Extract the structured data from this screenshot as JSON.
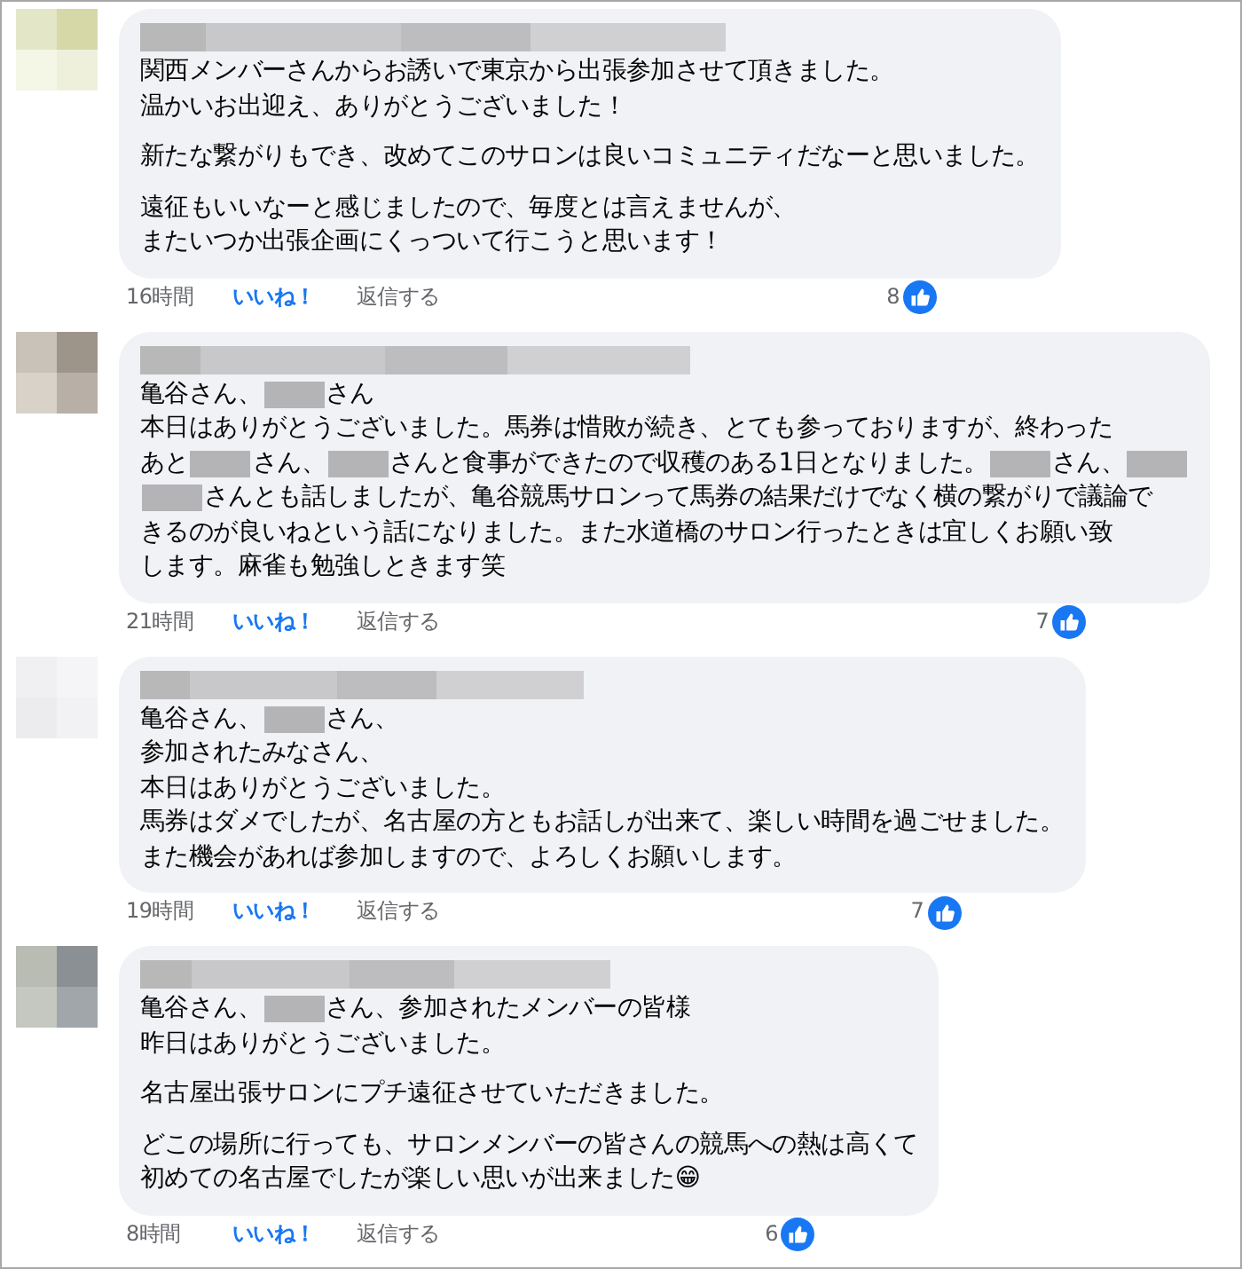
{
  "comments": [
    {
      "paragraphs": [
        [
          [
            {
              "kind": "text",
              "text": "関西メンバーさんからお誘いで東京から出張参加させて頂きました。"
            }
          ],
          [
            {
              "kind": "text",
              "text": "温かいお出迎え、ありがとうございました！"
            }
          ]
        ],
        [
          [
            {
              "kind": "text",
              "text": "新たな繋がりもでき、改めてこのサロンは良いコミュニティだなーと思いました。"
            }
          ]
        ],
        [
          [
            {
              "kind": "text",
              "text": "遠征もいいなーと感じましたので、毎度とは言えませんが、"
            }
          ],
          [
            {
              "kind": "text",
              "text": "またいつか出張企画にくっついて行こうと思います！"
            }
          ]
        ]
      ],
      "time": "16時間",
      "like": "いいね！",
      "reply": "返信する",
      "count": "8"
    },
    {
      "paragraphs": [
        [
          [
            {
              "kind": "text",
              "text": "亀谷さん、"
            },
            {
              "kind": "redacted"
            },
            {
              "kind": "text",
              "text": "さん"
            }
          ],
          [
            {
              "kind": "text",
              "text": "本日はありがとうございました。馬券は惜敗が続き、とても参っておりますが、終わった"
            }
          ],
          [
            {
              "kind": "text",
              "text": "あと"
            },
            {
              "kind": "redacted"
            },
            {
              "kind": "text",
              "text": "さん、"
            },
            {
              "kind": "redacted"
            },
            {
              "kind": "text",
              "text": "さんと食事ができたので収穫のある1日となりました。"
            },
            {
              "kind": "redacted"
            },
            {
              "kind": "text",
              "text": "さん、"
            },
            {
              "kind": "redacted"
            }
          ],
          [
            {
              "kind": "redacted"
            },
            {
              "kind": "text",
              "text": "さんとも話しましたが、亀谷競馬サロンって馬券の結果だけでなく横の繋がりで議論で"
            }
          ],
          [
            {
              "kind": "text",
              "text": "きるのが良いねという話になりました。また水道橋のサロン行ったときは宜しくお願い致"
            }
          ],
          [
            {
              "kind": "text",
              "text": "します。麻雀も勉強しときます笑"
            }
          ]
        ]
      ],
      "time": "21時間",
      "like": "いいね！",
      "reply": "返信する",
      "count": "7"
    },
    {
      "paragraphs": [
        [
          [
            {
              "kind": "text",
              "text": "亀谷さん、"
            },
            {
              "kind": "redacted"
            },
            {
              "kind": "text",
              "text": "さん、"
            }
          ],
          [
            {
              "kind": "text",
              "text": "参加されたみなさん、"
            }
          ],
          [
            {
              "kind": "text",
              "text": "本日はありがとうございました。"
            }
          ],
          [
            {
              "kind": "text",
              "text": "馬券はダメでしたが、名古屋の方ともお話しが出来て、楽しい時間を過ごせました。"
            }
          ],
          [
            {
              "kind": "text",
              "text": "また機会があれば参加しますので、よろしくお願いします。"
            }
          ]
        ]
      ],
      "time": "19時間",
      "like": "いいね！",
      "reply": "返信する",
      "count": "7"
    },
    {
      "paragraphs": [
        [
          [
            {
              "kind": "text",
              "text": "亀谷さん、"
            },
            {
              "kind": "redacted"
            },
            {
              "kind": "text",
              "text": "さん、参加されたメンバーの皆様"
            }
          ],
          [
            {
              "kind": "text",
              "text": "昨日はありがとうございました。"
            }
          ]
        ],
        [
          [
            {
              "kind": "text",
              "text": "名古屋出張サロンにプチ遠征させていただきました。"
            }
          ]
        ],
        [
          [
            {
              "kind": "text",
              "text": "どこの場所に行っても、サロンメンバーの皆さんの競馬への熱は高くて"
            }
          ],
          [
            {
              "kind": "text",
              "text": "初めての名古屋でしたが楽しい思いが出来ました😁"
            }
          ]
        ]
      ],
      "time": "8時間",
      "like": "いいね！",
      "reply": "返信する",
      "count": "6"
    }
  ]
}
